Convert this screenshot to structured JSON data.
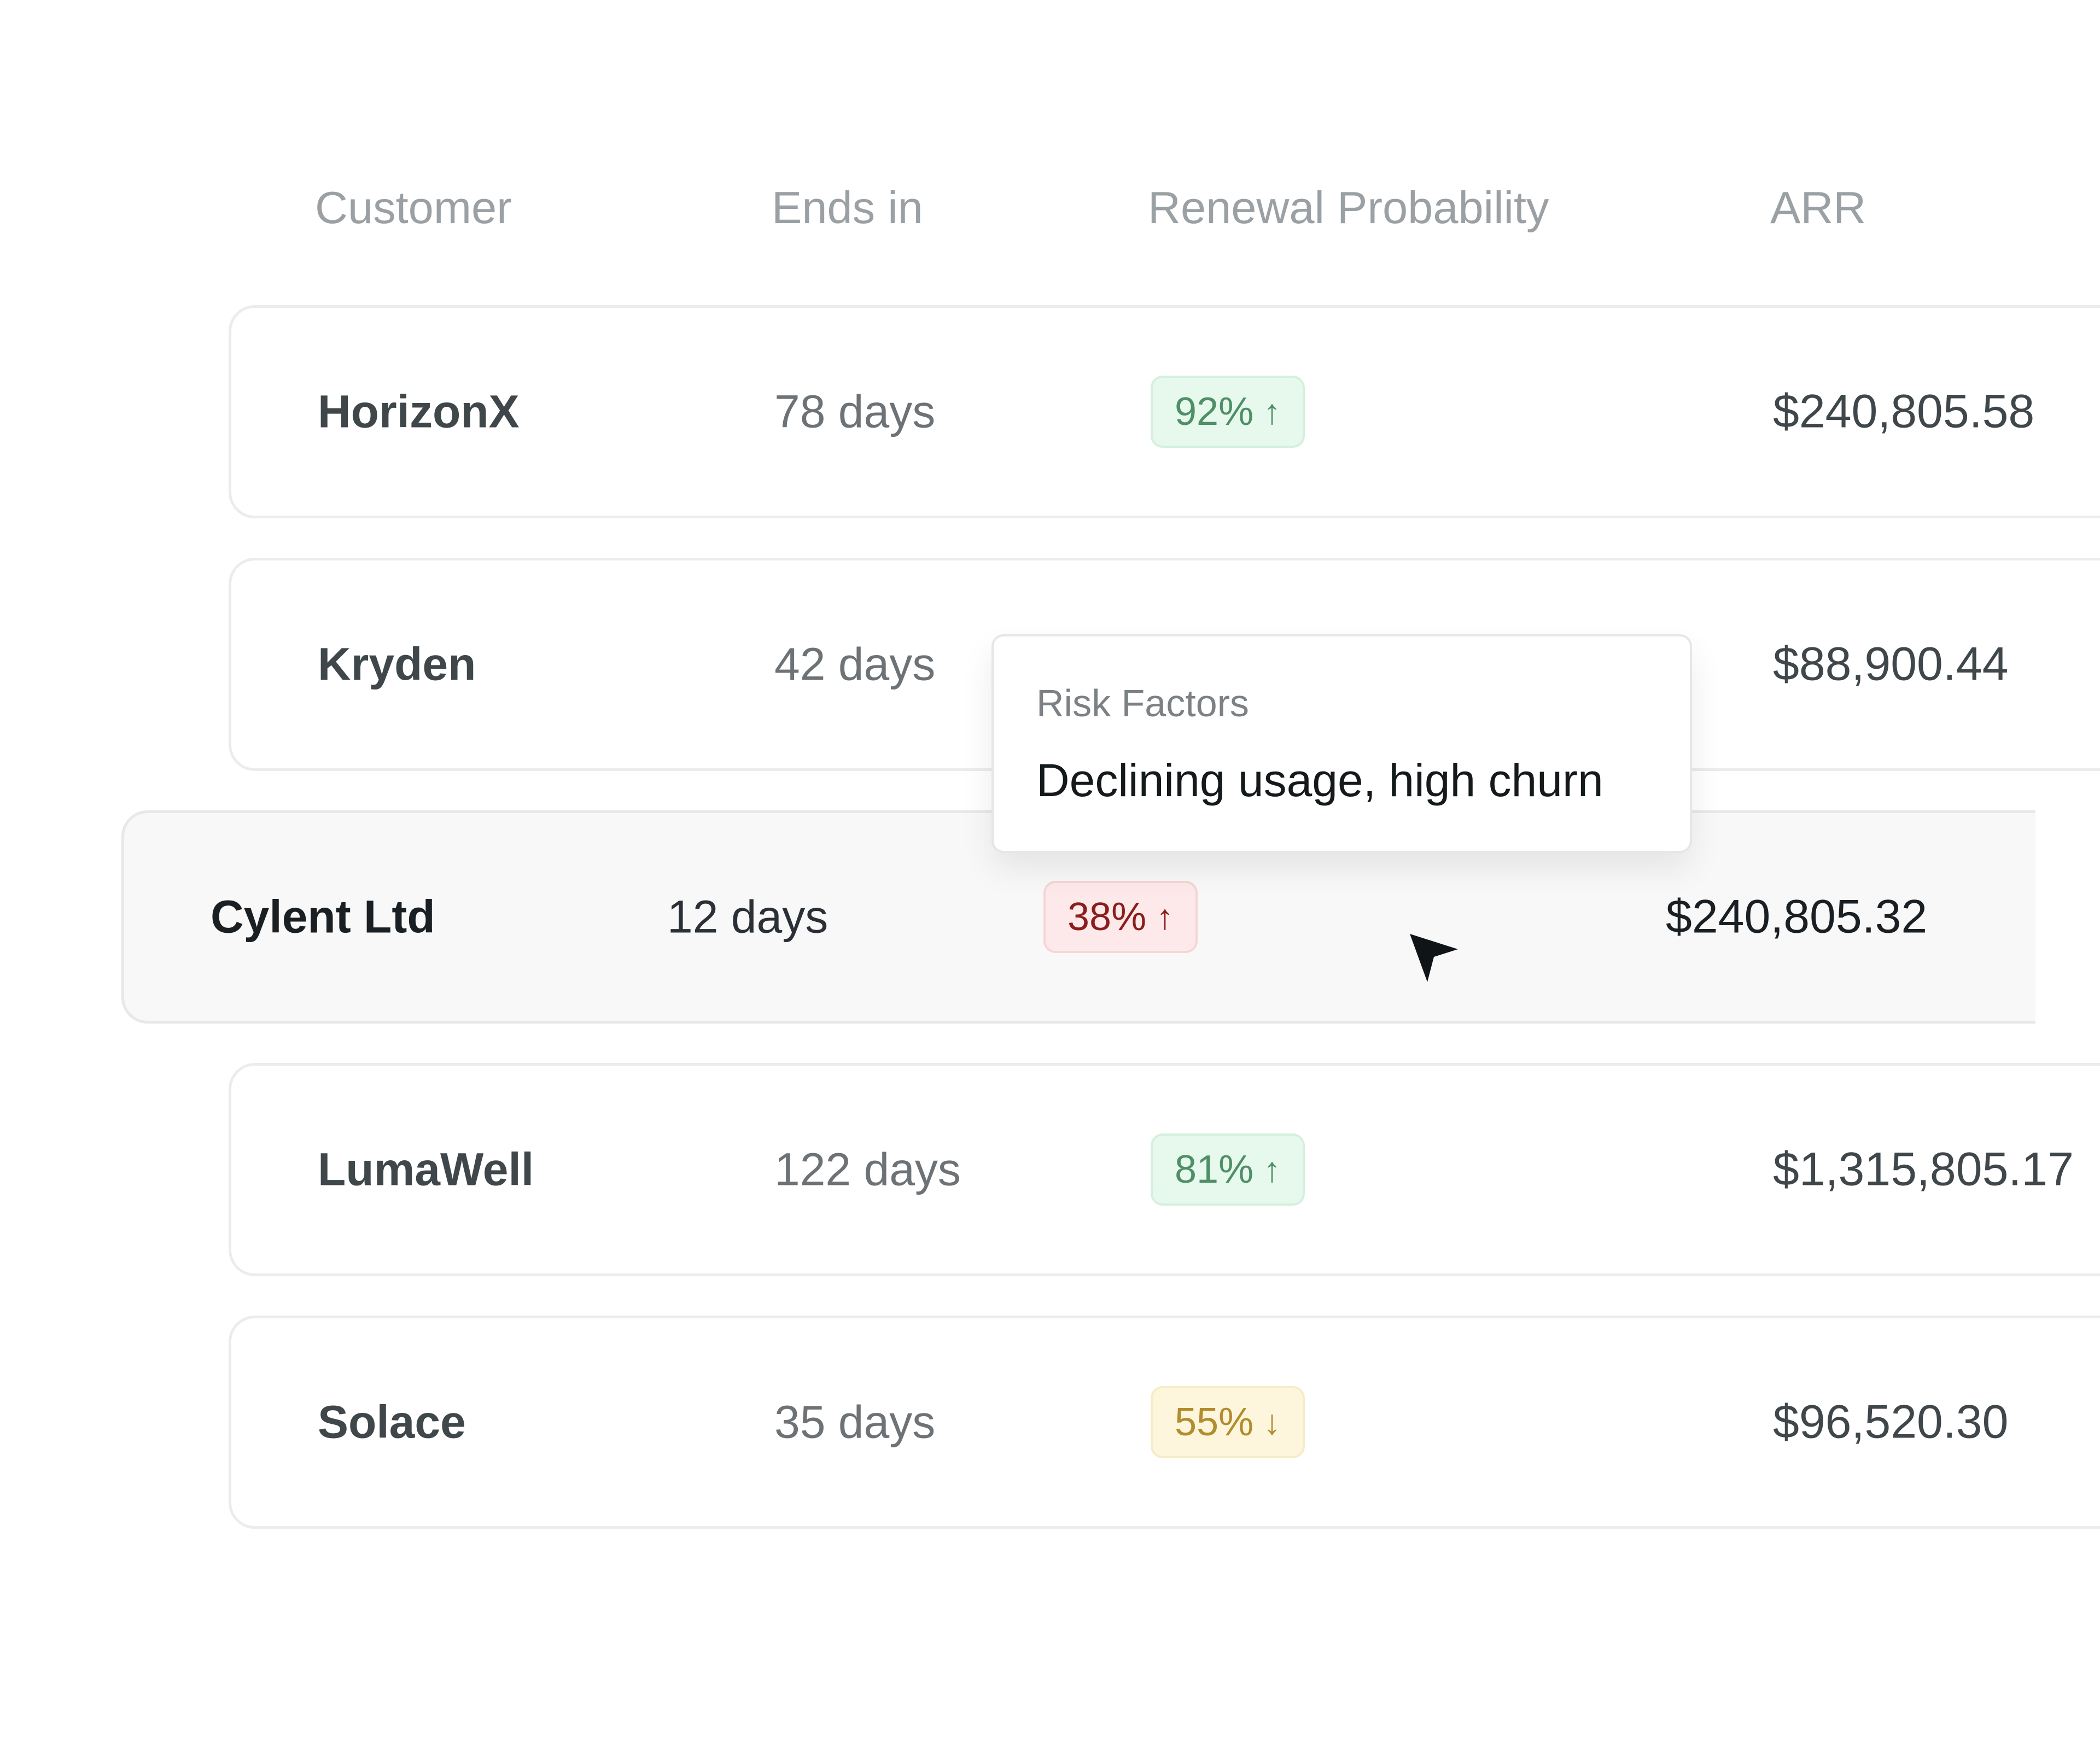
{
  "table": {
    "headers": {
      "customer": "Customer",
      "ends_in": "Ends in",
      "renewal_probability": "Renewal Probability",
      "arr": "ARR"
    },
    "rows": [
      {
        "customer": "HorizonX",
        "ends_in": "78 days",
        "probability": "92%",
        "trend": "↑",
        "status": "green",
        "arr": "$240,805.58"
      },
      {
        "customer": "Kryden",
        "ends_in": "42 days",
        "probability": "",
        "trend": "",
        "status": "hidden",
        "arr": "$88,900.44"
      },
      {
        "customer": "Cylent Ltd",
        "ends_in": "12 days",
        "probability": "38%",
        "trend": "↑",
        "status": "red",
        "arr": "$240,805.32"
      },
      {
        "customer": "LumaWell",
        "ends_in": "122 days",
        "probability": "81%",
        "trend": "↑",
        "status": "green",
        "arr": "$1,315,805.17"
      },
      {
        "customer": "Solace",
        "ends_in": "35 days",
        "probability": "55%",
        "trend": "↓",
        "status": "yellow",
        "arr": "$96,520.30"
      }
    ]
  },
  "tooltip": {
    "title": "Risk Factors",
    "body": "Declining usage, high churn"
  },
  "icons": {
    "cursor": "cursor-arrow-icon",
    "trend_up": "arrow-up-icon",
    "trend_down": "arrow-down-icon"
  },
  "colors": {
    "green": "#4f8f68",
    "red": "#8b1d1d",
    "yellow": "#b28d2e"
  }
}
